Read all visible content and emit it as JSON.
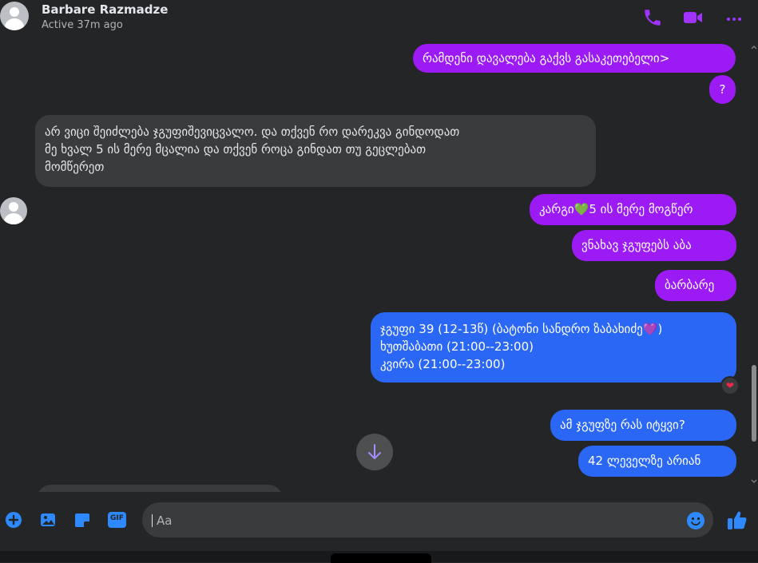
{
  "header": {
    "name": "Barbare Razmadze",
    "status": "Active 37m ago",
    "icons": [
      "phone-icon",
      "video-camera-icon",
      "more-options-icon"
    ]
  },
  "messages": [
    {
      "dir": "out",
      "color": "purple",
      "lines": [
        "რამდენი დავალება გაქვს გასაკეთებელი>"
      ]
    },
    {
      "dir": "out",
      "color": "purple",
      "lines": [
        "?"
      ]
    },
    {
      "dir": "in",
      "lines": [
        "არ ვიცი შეიძლება ჯგუფიშევიცვალო. და თქვენ რო დარეკვა გინდოდათ",
        "მე ხვალ 5 ის მერე მცალია და თქვენ როცა გინდათ თუ გეცლებათ",
        "მომწერეთ"
      ]
    },
    {
      "dir": "out",
      "color": "purple",
      "lines": [
        "კარგი💚5 ის მერე მოგწერ"
      ]
    },
    {
      "dir": "out",
      "color": "purple",
      "lines": [
        "ვნახავ ჯგუფებს აბა"
      ]
    },
    {
      "dir": "out",
      "color": "purple",
      "lines": [
        "ბარბარე"
      ]
    },
    {
      "dir": "out",
      "color": "blue",
      "lines": [
        "ჯგუფი 39 (12-13წ) (ბატონი სანდრო ზაბახიძე💜)",
        "ხუთშაბათი (21:00--23:00)",
        "კვირა (21:00--23:00)"
      ],
      "reaction": "❤"
    },
    {
      "dir": "out",
      "color": "blue",
      "lines": [
        "ამ ჯგუფზე რას იტყვი?"
      ]
    },
    {
      "dir": "out",
      "color": "blue",
      "lines": [
        "42 ლეველზე არიან"
      ]
    }
  ],
  "composer": {
    "placeholder": "Aa",
    "icons": [
      "add-icon",
      "image-icon",
      "sticker-icon",
      "gif-icon",
      "emoji-icon",
      "thumbs-up-icon"
    ],
    "gif_label": "GIF"
  },
  "colors": {
    "accent": "#a033ff",
    "purple_bubble": "#9c1bf5",
    "blue_bubble": "#2a67f4",
    "incoming_bubble": "#3a3b3c",
    "background": "#242526"
  }
}
